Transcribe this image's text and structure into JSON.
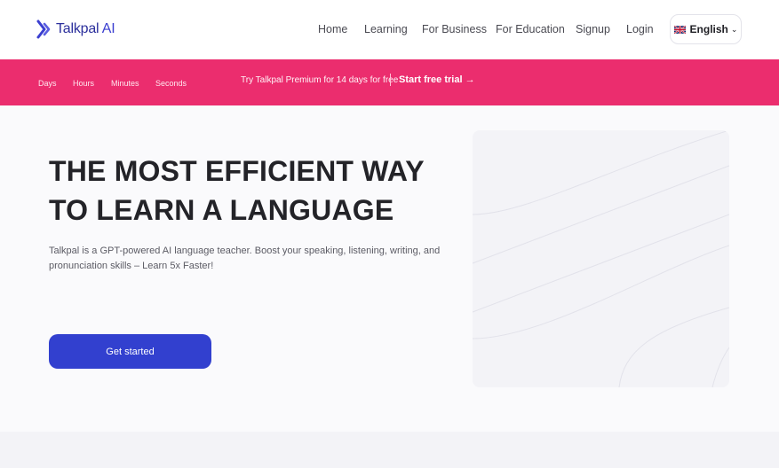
{
  "brand": {
    "name": "Talkpal",
    "suffix": "AI",
    "accent": "#3b3fd0"
  },
  "nav": {
    "links": [
      "Home",
      "Learning",
      "For Business",
      "For Education",
      "Signup",
      "Login"
    ],
    "language": {
      "label": "English",
      "flag_icon": "uk-flag-icon",
      "chevron_icon": "chevron-down-icon"
    }
  },
  "promo": {
    "background": "#eb2d6e",
    "timer_labels": [
      "Days",
      "Hours",
      "Minutes",
      "Seconds"
    ],
    "text": "Try Talkpal Premium for 14 days for free",
    "cta": "Start free trial",
    "cta_icon": "arrow-right-icon"
  },
  "hero": {
    "title_line1": "THE MOST EFFICIENT WAY",
    "title_line2": "TO LEARN A LANGUAGE",
    "subtitle": "Talkpal is a GPT-powered AI language teacher. Boost your speaking, listening, writing, and pronunciation skills – Learn 5x Faster!",
    "cta": "Get started",
    "cta_color": "#3240cf"
  }
}
